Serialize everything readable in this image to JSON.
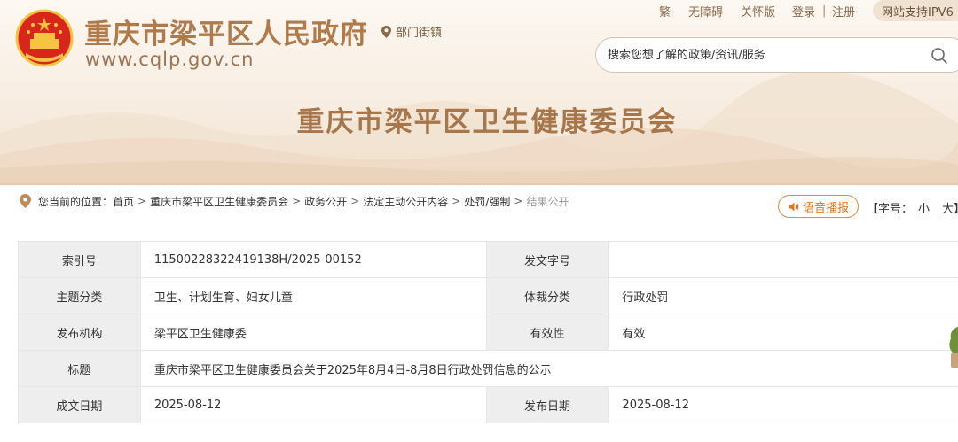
{
  "header": {
    "site_title": "重庆市梁平区人民政府",
    "site_url": "www.cqlp.gov.cn",
    "dept_link": "部门街镇",
    "dept_title": "重庆市梁平区卫生健康委员会"
  },
  "topnav": {
    "traditional": "繁",
    "accessibility": "无障碍",
    "care_mode": "关怀版",
    "login": "登录",
    "separator": "|",
    "register": "注册",
    "ipv6": "网站支持IPV6"
  },
  "search": {
    "placeholder": "搜索您想了解的政策/资讯/服务"
  },
  "breadcrumb": {
    "prefix": "您当前的位置：",
    "items": [
      "首页",
      "重庆市梁平区卫生健康委员会",
      "政务公开",
      "法定主动公开内容",
      "处罚/强制"
    ],
    "current": "结果公开",
    "sep": ">"
  },
  "tools": {
    "voice": "语音播报",
    "fontsize_label": "【字号：",
    "fontsize_small": "小",
    "fontsize_large": "大】"
  },
  "meta_table": {
    "rows": [
      {
        "l1": "索引号",
        "v1": "11500228322419138H/2025-00152",
        "l2": "发文字号",
        "v2": ""
      },
      {
        "l1": "主题分类",
        "v1": "卫生、计划生育、妇女儿童",
        "l2": "体裁分类",
        "v2": "行政处罚"
      },
      {
        "l1": "发布机构",
        "v1": "梁平区卫生健康委",
        "l2": "有效性",
        "v2": "有效"
      },
      {
        "l1": "标题",
        "v1": "重庆市梁平区卫生健康委员会关于2025年8月4日-8月8日行政处罚信息的公示"
      },
      {
        "l1": "成文日期",
        "v1": "2025-08-12",
        "l2": "发布日期",
        "v2": "2025-08-12"
      }
    ]
  },
  "colors": {
    "title_brown": "#b07a4a",
    "accent_orange": "#e0741d",
    "label_bg": "#eeeeee",
    "emblem_red": "#d8261c",
    "emblem_gold": "#f5c542"
  }
}
